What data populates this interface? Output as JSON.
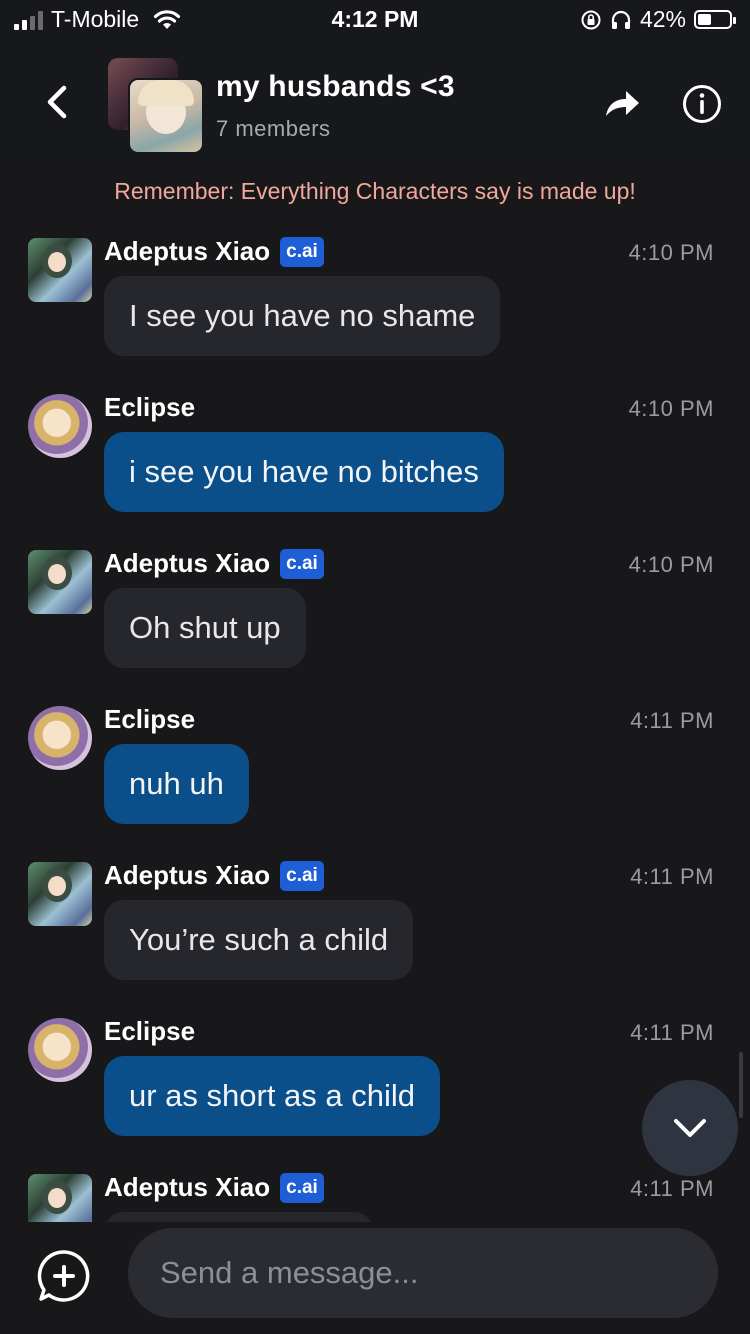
{
  "status_bar": {
    "carrier": "T-Mobile",
    "time": "4:12 PM",
    "battery_percent": "42%",
    "battery_level": 0.42,
    "icons": [
      "signal-icon",
      "wifi-icon",
      "orientation-lock-icon",
      "headphones-icon",
      "battery-icon"
    ]
  },
  "header": {
    "title": "my husbands <3",
    "subtitle": "7 members",
    "icons": [
      "back-chevron-icon",
      "share-icon",
      "info-icon"
    ]
  },
  "notice": "Remember: Everything Characters say is made up!",
  "messages": [
    {
      "sender": "Adeptus Xiao",
      "badge": "c.ai",
      "time": "4:10 PM",
      "text": "I see you have no shame",
      "role": "character"
    },
    {
      "sender": "Eclipse",
      "time": "4:10 PM",
      "text": "i see you have no bitches",
      "role": "user"
    },
    {
      "sender": "Adeptus Xiao",
      "badge": "c.ai",
      "time": "4:10 PM",
      "text": "Oh shut up",
      "role": "character"
    },
    {
      "sender": "Eclipse",
      "time": "4:11 PM",
      "text": "nuh uh",
      "role": "user"
    },
    {
      "sender": "Adeptus Xiao",
      "badge": "c.ai",
      "time": "4:11 PM",
      "text": "You’re such a child",
      "role": "character"
    },
    {
      "sender": "Eclipse",
      "time": "4:11 PM",
      "text": "ur as short as a child",
      "role": "user"
    },
    {
      "sender": "Adeptus Xiao",
      "badge": "c.ai",
      "time": "4:11 PM",
      "text": "",
      "role": "character"
    }
  ],
  "composer": {
    "placeholder": "Send a message..."
  },
  "colors": {
    "background": "#18181b",
    "character_bubble": "#26272c",
    "user_bubble": "#0b4f8a",
    "badge": "#1e5fd8",
    "notice": "#f1a89a"
  }
}
